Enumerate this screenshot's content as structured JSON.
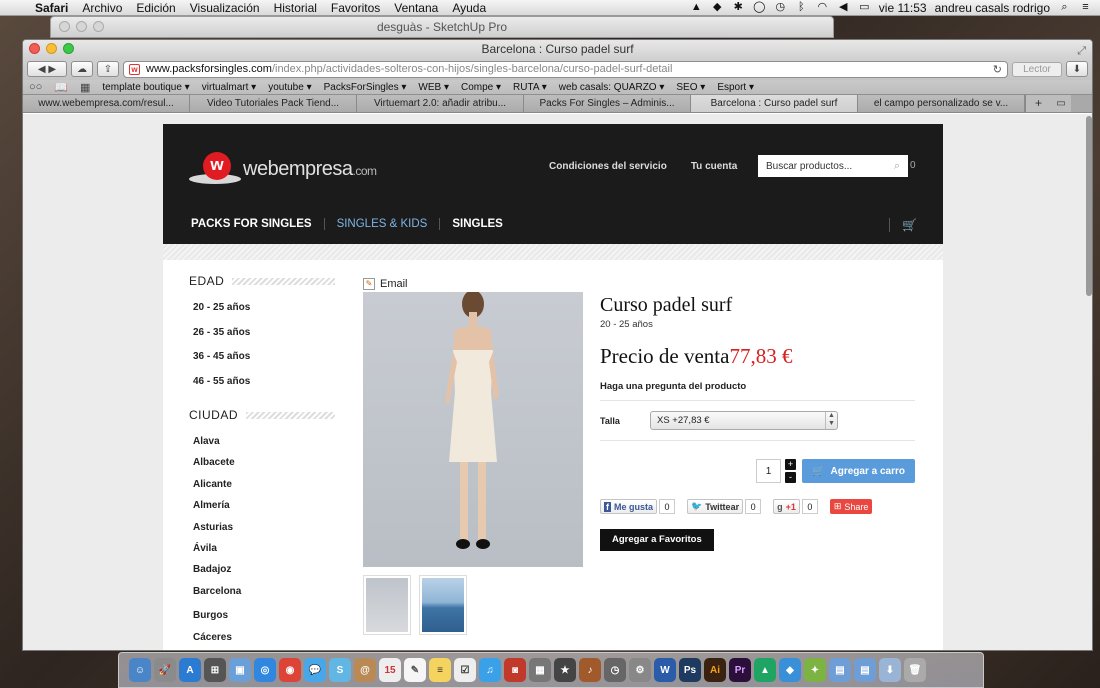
{
  "menubar": {
    "app": "Safari",
    "items": [
      "Archivo",
      "Edición",
      "Visualización",
      "Historial",
      "Favoritos",
      "Ventana",
      "Ayuda"
    ],
    "clock": "vie 11:53",
    "user": "andreu casals rodrigo"
  },
  "bg_window": {
    "title": "desguàs - SketchUp Pro"
  },
  "browser": {
    "title": "Barcelona : Curso padel surf",
    "url_domain": "www.packsforsingles.com",
    "url_path": "/index.php/actividades-solteros-con-hijos/singles-barcelona/curso-padel-surf-detail",
    "reader_label": "Lector",
    "bookmarks": [
      "template boutique ▾",
      "virtualmart ▾",
      "youtube ▾",
      "PacksForSingles ▾",
      "WEB ▾",
      "Compe ▾",
      "RUTA ▾",
      "web casals: QUARZO ▾",
      "SEO ▾",
      "Esport ▾"
    ],
    "tabs": [
      {
        "label": "www.webempresa.com/resul...",
        "active": false
      },
      {
        "label": "Video Tutoriales Pack Tiend...",
        "active": false
      },
      {
        "label": "Virtuemart 2.0: añadir atribu...",
        "active": false
      },
      {
        "label": "Packs For Singles – Adminis...",
        "active": false
      },
      {
        "label": "Barcelona : Curso padel surf",
        "active": true
      },
      {
        "label": "el campo personalizado se v...",
        "active": false
      }
    ]
  },
  "site": {
    "logo": "webempresa",
    "logo_suffix": ".com",
    "header_links": [
      "Condiciones del servicio",
      "Tu cuenta"
    ],
    "search_placeholder": "Buscar productos...",
    "cart_count": "0",
    "nav": [
      "PACKS FOR SINGLES",
      "SINGLES & KIDS",
      "SINGLES"
    ]
  },
  "sidebar": {
    "age_heading": "EDAD",
    "ages": [
      "20 - 25 años",
      "26 - 35 años",
      "36 - 45 años",
      "46 - 55 años"
    ],
    "city_heading": "CIUDAD",
    "cities": [
      "Alava",
      "Albacete",
      "Alicante",
      "Almería",
      "Asturias",
      "Ávila",
      "Badajoz",
      "Barcelona",
      "Burgos",
      "Cáceres"
    ]
  },
  "product": {
    "email_label": "Email",
    "title": "Curso padel surf",
    "subtitle": "20 - 25 años",
    "price_label": "Precio de venta",
    "price": "77,83 €",
    "ask_link": "Haga una pregunta del producto",
    "size_label": "Talla",
    "size_value": "XS +27,83 €",
    "quantity": "1",
    "add_to_cart": "Agregar a carro",
    "social": {
      "facebook": "Me gusta",
      "facebook_count": "0",
      "twitter": "Twittear",
      "twitter_count": "0",
      "gplus": "+1",
      "gplus_count": "0",
      "share": "Share"
    },
    "favorites": "Agregar a Favoritos"
  },
  "colors": {
    "header_bg": "#1b1b1b",
    "price_red": "#d7211e",
    "cart_blue": "#5a9bdb",
    "nav_kids": "#7fb4e6"
  }
}
